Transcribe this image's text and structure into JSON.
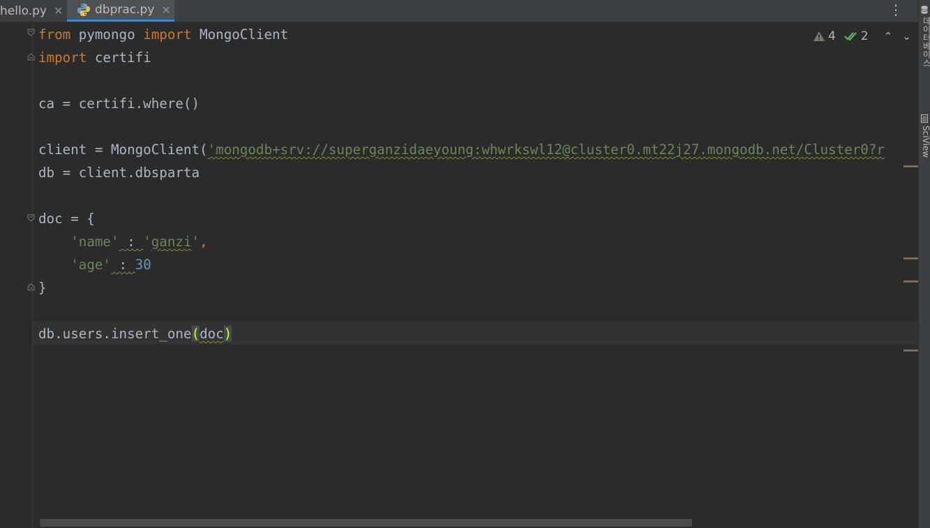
{
  "tabs": [
    {
      "label": "hello.py",
      "active": false
    },
    {
      "label": "dbprac.py",
      "active": true
    }
  ],
  "tab_close_glyph": "✕",
  "tab_menu_glyph": "⋮",
  "right_panel": {
    "database_label": "데이터베이스",
    "sciview_label": "SciView"
  },
  "inspections": {
    "warnings_count": "4",
    "weak_warnings_count": "2",
    "prev_glyph": "⌃",
    "next_glyph": "⌄"
  },
  "code": {
    "line1": {
      "kw1": "from",
      "mod": " pymongo ",
      "kw2": "import",
      "name": " MongoClient"
    },
    "line2": {
      "kw": "import",
      "name": " certifi"
    },
    "line4": "ca = certifi.where()",
    "line6": {
      "pre": "client = MongoClient(",
      "url": "'mongodb+srv://superganzidaeyoung:whwrkswl12@cluster0.mt22j27.mongodb.net/Cluster0?r"
    },
    "line7": "db = client.dbsparta",
    "line9": "doc = {",
    "line10": {
      "indent": "    ",
      "key": "'name'",
      "sep": " : ",
      "quote_open": "'",
      "val": "ganzi",
      "quote_close": "'",
      "comma": ","
    },
    "line11": {
      "indent": "    ",
      "key": "'age'",
      "sep": " : ",
      "num": "30"
    },
    "line12": "}",
    "line14": {
      "pre": "db.users.insert_one",
      "open": "(",
      "arg": "doc",
      "close": ")"
    }
  }
}
